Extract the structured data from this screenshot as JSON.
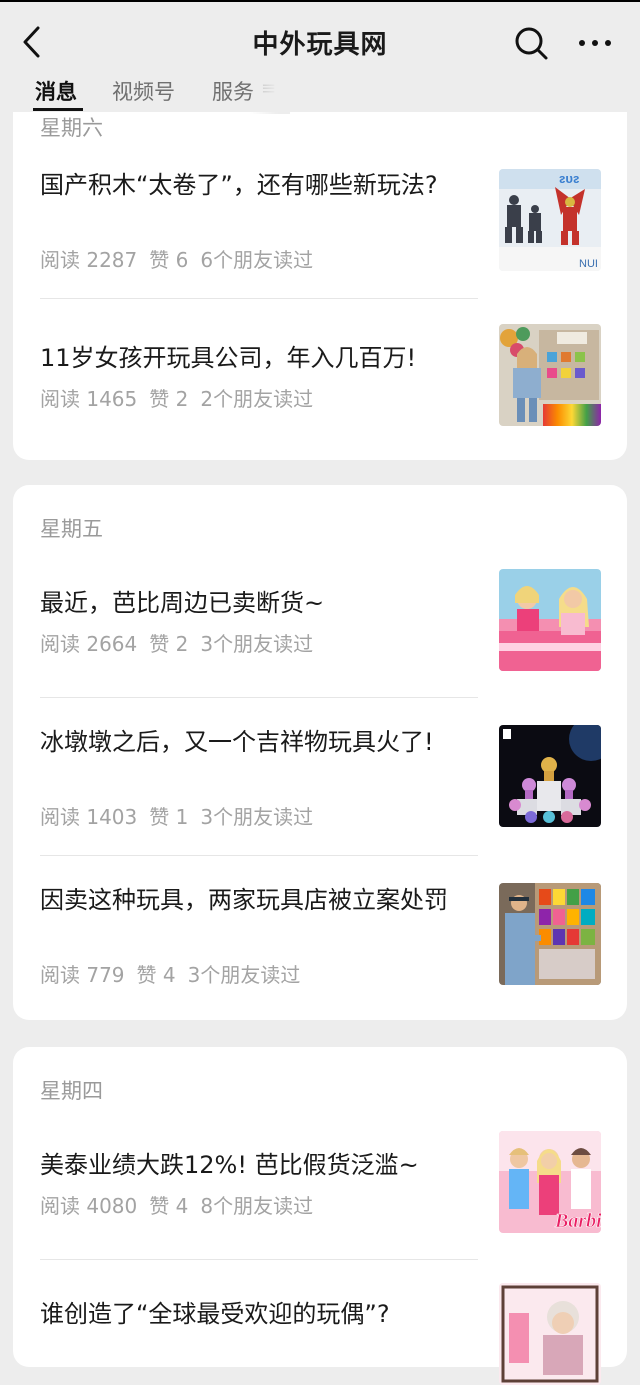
{
  "header": {
    "title": "中外玩具网"
  },
  "tabs": [
    {
      "label": "消息"
    },
    {
      "label": "视频号"
    },
    {
      "label": "服务"
    }
  ],
  "groups": [
    {
      "day": "星期六",
      "articles": [
        {
          "title": "国产积木“太卷了”，还有哪些新玩法?",
          "read": "阅读 2287",
          "likes": "赞 6",
          "friends": "6个朋友读过"
        },
        {
          "title": "11岁女孩开玩具公司，年入几百万!",
          "read": "阅读 1465",
          "likes": "赞 2",
          "friends": "2个朋友读过"
        }
      ]
    },
    {
      "day": "星期五",
      "articles": [
        {
          "title": "最近，芭比周边已卖断货~",
          "read": "阅读 2664",
          "likes": "赞 2",
          "friends": "3个朋友读过"
        },
        {
          "title": "冰墩墩之后，又一个吉祥物玩具火了!",
          "read": "阅读 1403",
          "likes": "赞 1",
          "friends": "3个朋友读过"
        },
        {
          "title": "因卖这种玩具，两家玩具店被立案处罚",
          "read": "阅读 779",
          "likes": "赞 4",
          "friends": "3个朋友读过"
        }
      ]
    },
    {
      "day": "星期四",
      "articles": [
        {
          "title": "美泰业绩大跌12%! 芭比假货泛滥~",
          "read": "阅读 4080",
          "likes": "赞 4",
          "friends": "8个朋友读过"
        },
        {
          "title": "谁创造了“全球最受欢迎的玩偶”?",
          "read": "",
          "likes": "",
          "friends": ""
        }
      ]
    }
  ],
  "thumb_labels": {
    "barbie_logo": "Barbie"
  },
  "colors": {
    "background": "#ededed",
    "card": "#ffffff",
    "meta_text": "#a3a3a3",
    "title_text": "#1a1a1a"
  }
}
